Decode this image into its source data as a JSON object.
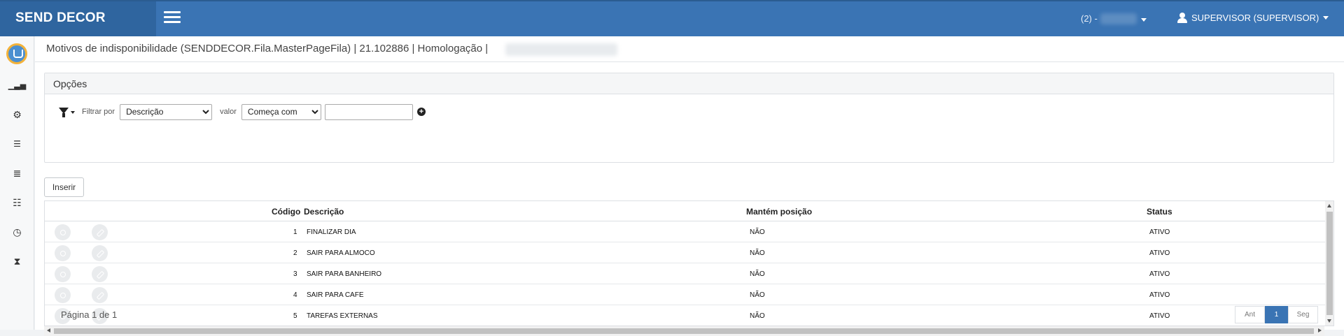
{
  "header": {
    "brand": "SEND DECOR",
    "branch": "(2) -",
    "user": "SUPERVISOR (SUPERVISOR)"
  },
  "sidebar": {
    "items": [
      {
        "icon": "chart-icon",
        "glyph": "📊"
      },
      {
        "icon": "gears-icon",
        "glyph": "⚙"
      },
      {
        "icon": "sliders-icon",
        "glyph": "☰"
      },
      {
        "icon": "ordered-list-icon",
        "glyph": "≣"
      },
      {
        "icon": "list-icon",
        "glyph": "☷"
      },
      {
        "icon": "clock-icon",
        "glyph": "◷"
      },
      {
        "icon": "hourglass-icon",
        "glyph": "⌛"
      }
    ]
  },
  "page": {
    "title": "Motivos de indisponibilidade (SENDDECOR.Fila.MasterPageFila) | 21.102886 | Homologação |"
  },
  "options": {
    "title": "Opções",
    "filter_by_label": "Filtrar por",
    "filter_field": "Descrição",
    "value_label": "valor",
    "comparison": "Começa com",
    "value": ""
  },
  "insert_label": "Inserir",
  "grid": {
    "columns": [
      "Código",
      "Descrição",
      "Mantém posição",
      "Status"
    ],
    "rows": [
      {
        "codigo": "1",
        "descricao": "FINALIZAR DIA",
        "mantem": "NÃO",
        "status": "ATIVO"
      },
      {
        "codigo": "2",
        "descricao": "SAIR PARA ALMOCO",
        "mantem": "NÃO",
        "status": "ATIVO"
      },
      {
        "codigo": "3",
        "descricao": "SAIR PARA BANHEIRO",
        "mantem": "NÃO",
        "status": "ATIVO"
      },
      {
        "codigo": "4",
        "descricao": "SAIR PARA CAFE",
        "mantem": "NÃO",
        "status": "ATIVO"
      },
      {
        "codigo": "5",
        "descricao": "TAREFAS EXTERNAS",
        "mantem": "NÃO",
        "status": "ATIVO"
      }
    ]
  },
  "pager": {
    "text": "Página 1 de 1",
    "prev": "Ant",
    "current": "1",
    "next": "Seg"
  }
}
